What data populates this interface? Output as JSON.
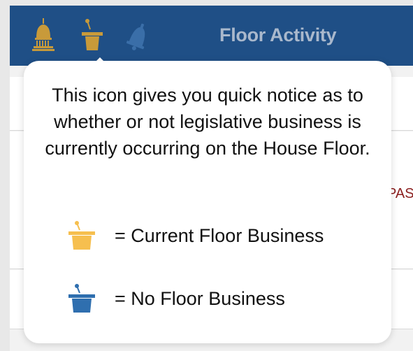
{
  "nav": {
    "title": "Floor Activity",
    "icons": [
      "capitol-icon",
      "podium-icon",
      "bell-icon"
    ],
    "colors": {
      "bar": "#1f4f86",
      "active_icon": "#c89a3a",
      "inactive_icon": "#3a6ea8",
      "title": "#a9b8cc"
    }
  },
  "background": {
    "partial_label": "PAS"
  },
  "popover": {
    "description": "This icon gives you quick notice as to whether or not legislative business is currently occurring on the House Floor.",
    "legend": [
      {
        "icon": "podium-icon",
        "color": "#f6bf4f",
        "label": "= Current Floor Business"
      },
      {
        "icon": "podium-icon",
        "color": "#2f6faf",
        "label": "= No Floor Business"
      }
    ]
  }
}
